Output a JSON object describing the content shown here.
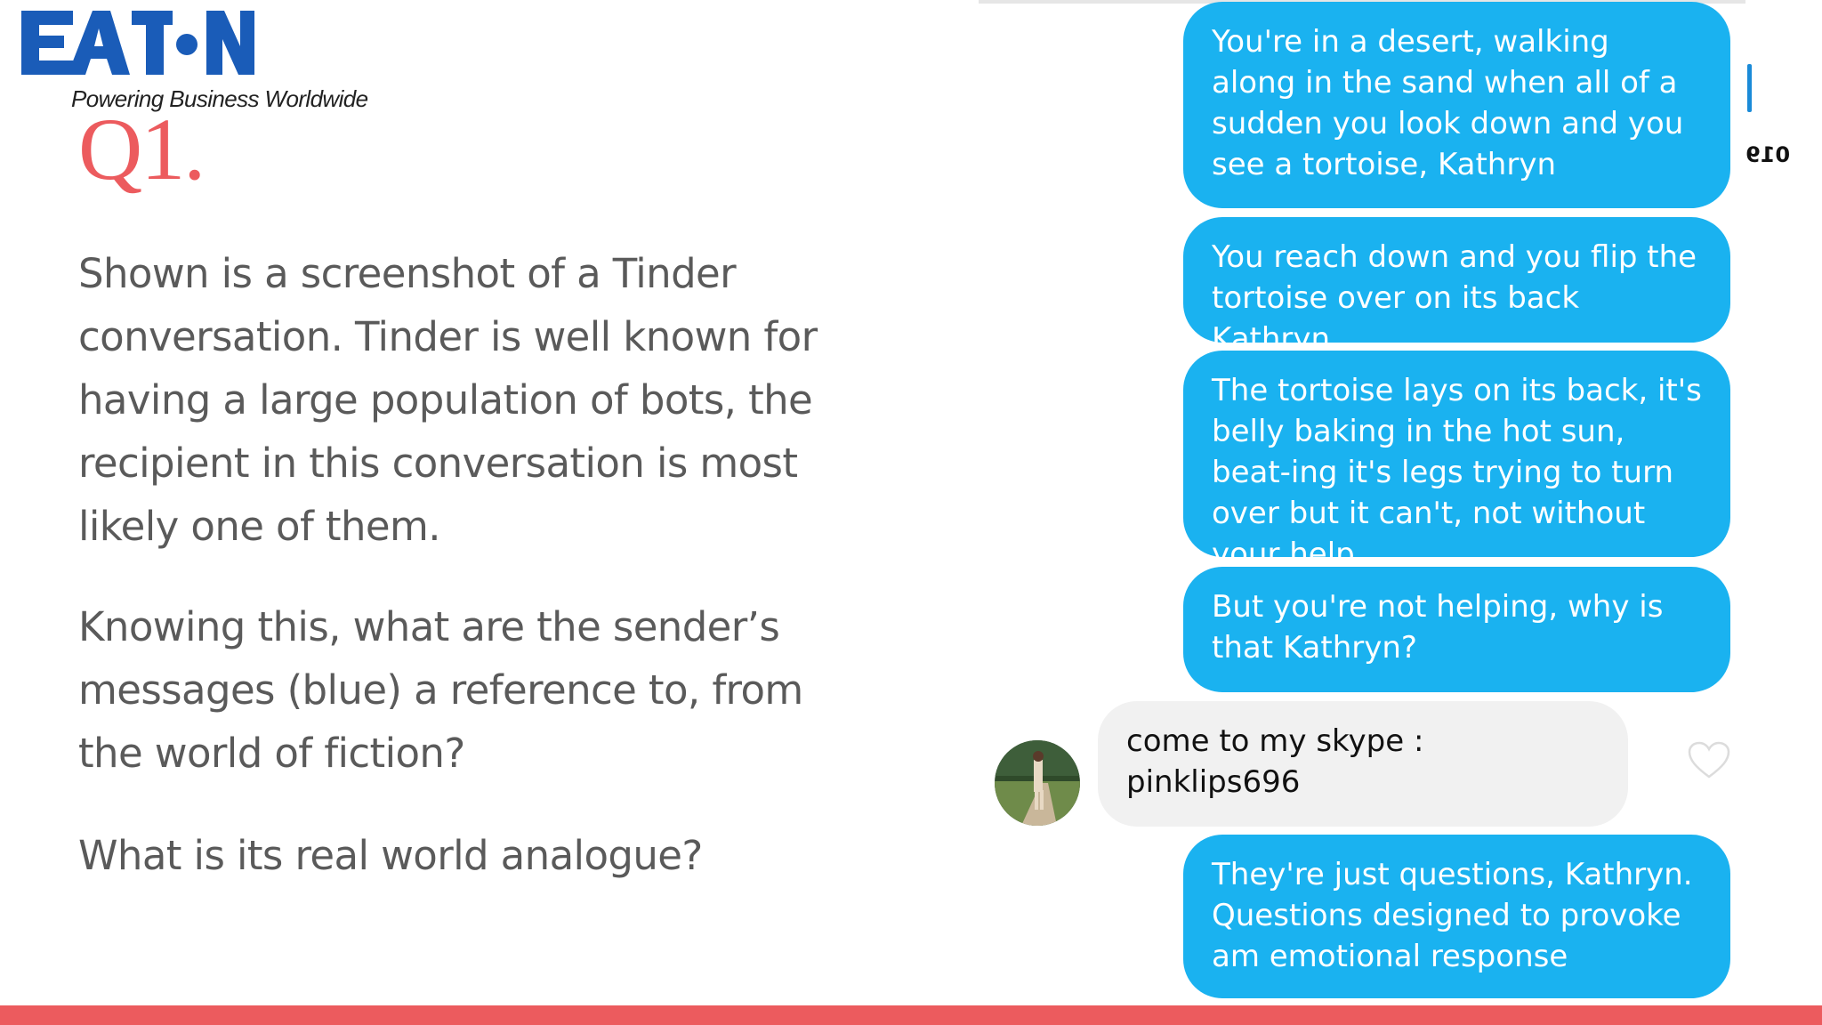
{
  "brand": {
    "name": "EATON",
    "tagline": "Powering Business Worldwide",
    "logo_color": "#1a5cb8"
  },
  "slide": {
    "heading": "Q1.",
    "paragraphs": [
      "Shown is a screenshot of a Tinder conversation. Tinder is well known for having a large population of bots, the recipient in this conversation is most likely one of them.",
      "Knowing this, what are the sender’s messages (blue) a reference to, from the world of fiction?",
      "What is its real world analogue?"
    ],
    "accent_color": "#ec5b5e",
    "text_color": "#5a5a5a"
  },
  "chat": {
    "date_fragment": "019",
    "sent_color": "#1ab2f0",
    "received_color": "#f1f1f1",
    "messages": [
      {
        "direction": "sent",
        "text": "You're in a desert, walking along in the sand when all of a sudden you look down and you see a tortoise, Kathryn"
      },
      {
        "direction": "sent",
        "text": "You reach down and you flip the tortoise over on its back Kathryn"
      },
      {
        "direction": "sent",
        "text": "The tortoise lays on its back, it's belly baking in the hot sun, beat-ing it's legs trying to turn over but it can't, not without your help"
      },
      {
        "direction": "sent",
        "text": "But you're not helping, why is that Kathryn?"
      },
      {
        "direction": "received",
        "text": "come to my skype : pinklips696"
      },
      {
        "direction": "sent",
        "text": "They're just questions, Kathryn. Questions designed to provoke am emotional response"
      }
    ]
  }
}
